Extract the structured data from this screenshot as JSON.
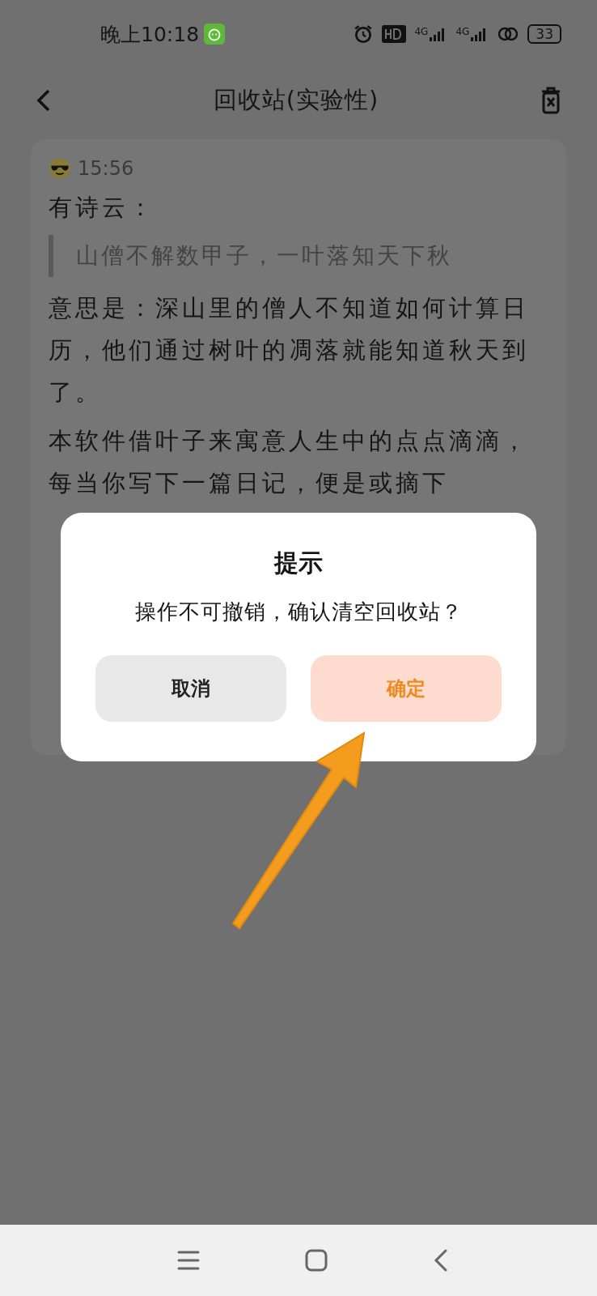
{
  "status_bar": {
    "time": "晚上10:18",
    "network_labels": [
      "4G",
      "4G"
    ],
    "battery": "33"
  },
  "header": {
    "title": "回收站(实验性)"
  },
  "entry": {
    "time": "15:56",
    "intro": "有诗云：",
    "quote": "山僧不解数甲子，一叶落知天下秋",
    "paragraphs": [
      "意思是：深山里的僧人不知道如何计算日历，他们通过树叶的凋落就能知道秋天到了。",
      "本软件借叶子来寓意人生中的点点滴滴，每当你写下一篇日记，便是或摘下"
    ]
  },
  "dialog": {
    "title": "提示",
    "message": "操作不可撤销，确认清空回收站？",
    "buttons": [
      {
        "label": "取消",
        "kind": "cancel"
      },
      {
        "label": "确定",
        "kind": "confirm"
      }
    ]
  }
}
